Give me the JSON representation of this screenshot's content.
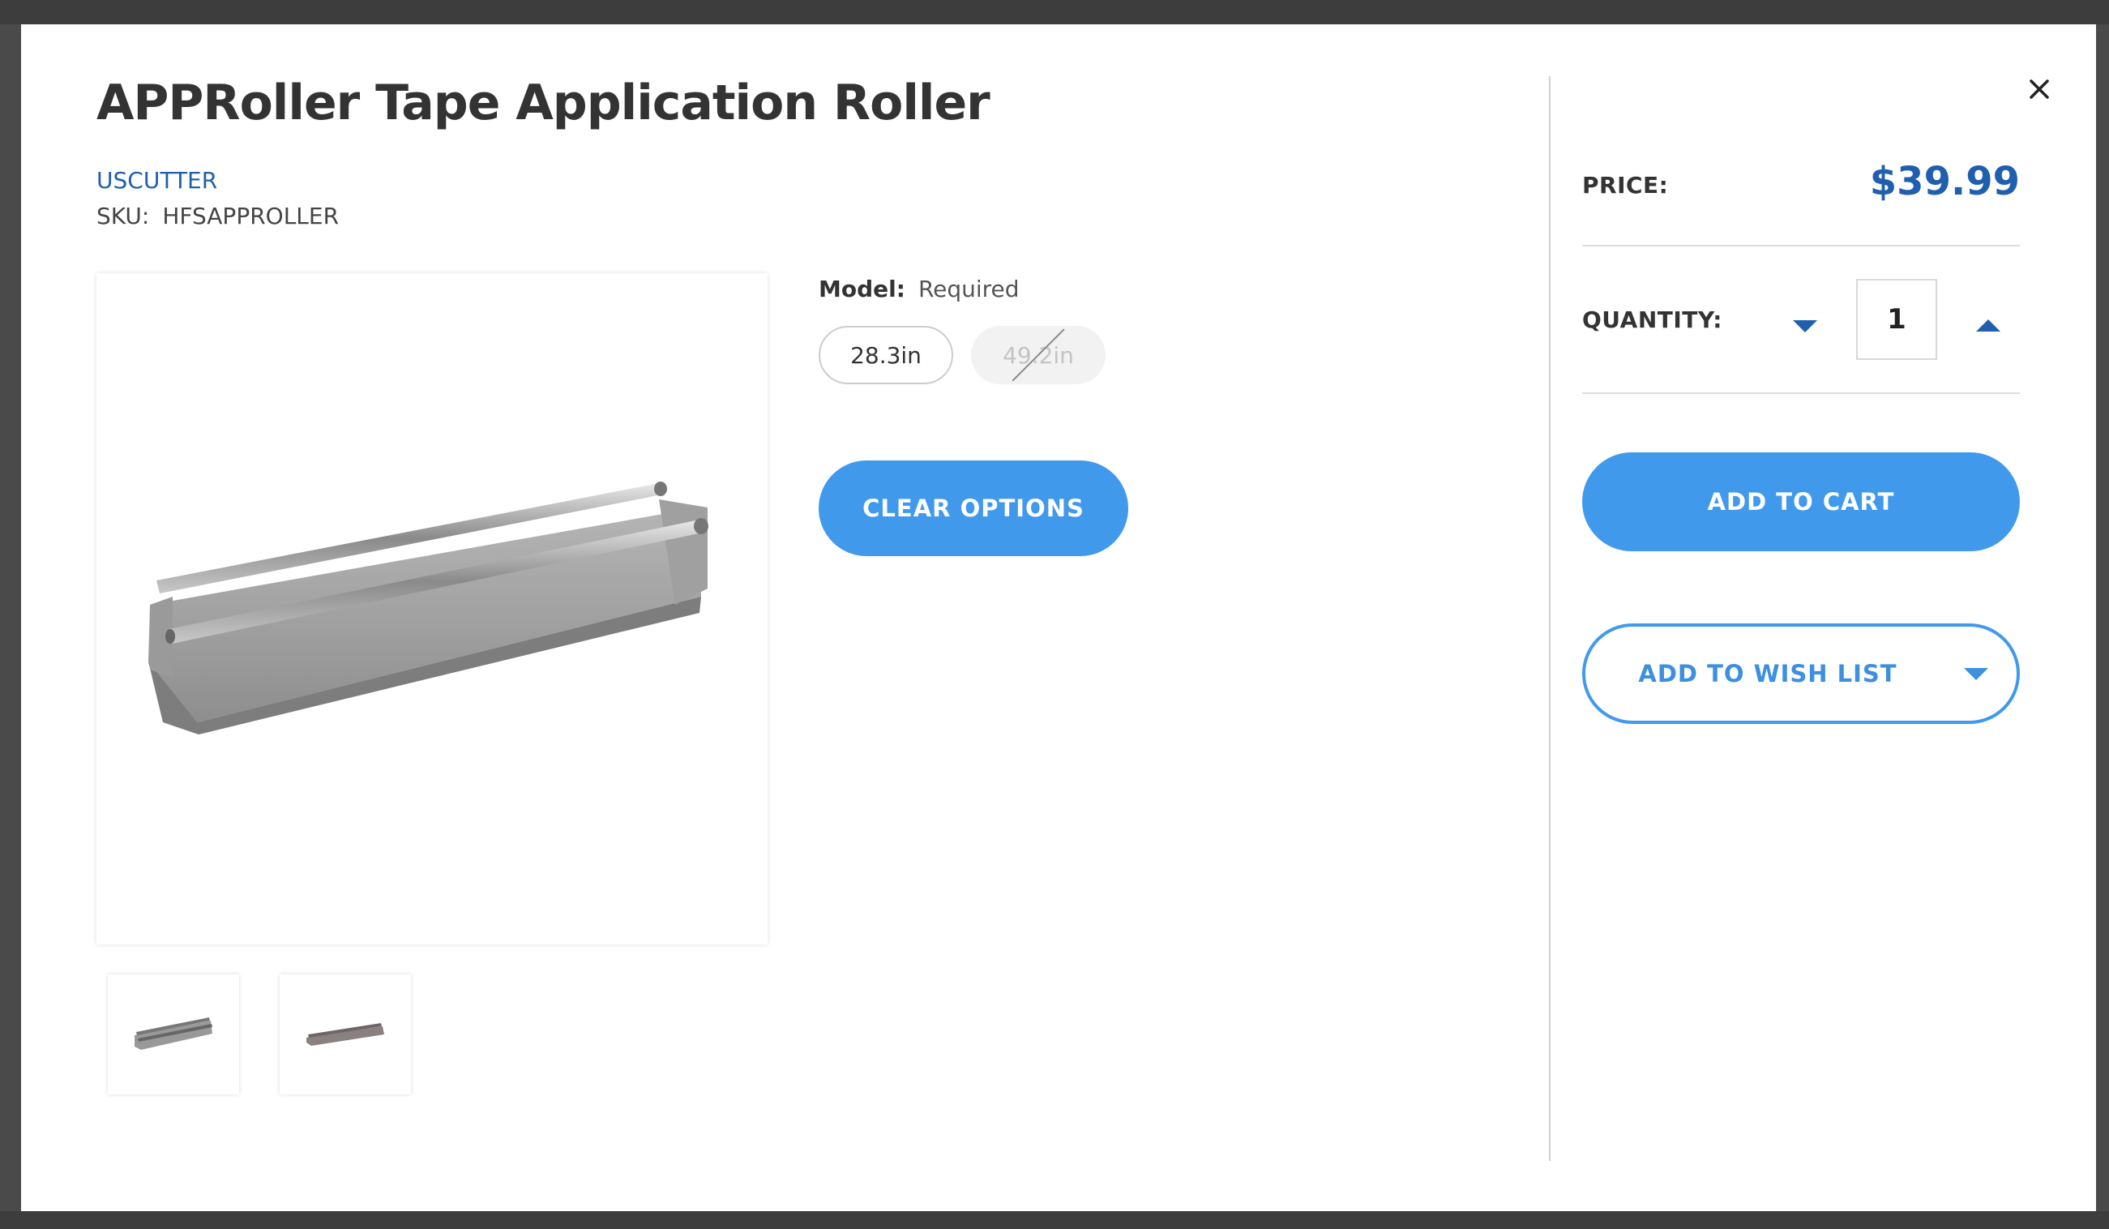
{
  "product": {
    "title": "APPRoller Tape Application Roller",
    "brand": "USCUTTER",
    "sku_label": "SKU:",
    "sku_value": "HFSAPPROLLER"
  },
  "gallery": {
    "main_image": "product-photo-tape-application-roller",
    "thumbnails": [
      "thumbnail-1",
      "thumbnail-2"
    ]
  },
  "options": {
    "model_label": "Model:",
    "model_required": "Required",
    "values": [
      {
        "label": "28.3in",
        "available": true
      },
      {
        "label": "49.2in",
        "available": false
      }
    ],
    "clear_label": "CLEAR OPTIONS"
  },
  "purchase": {
    "price_label": "PRICE:",
    "price_value": "$39.99",
    "quantity_label": "QUANTITY:",
    "quantity_value": "1",
    "add_to_cart_label": "ADD TO CART",
    "add_to_wishlist_label": "ADD TO WISH LIST"
  },
  "icons": {
    "close": "close-icon",
    "quantity_decrease": "caret-down-icon",
    "quantity_increase": "caret-up-icon",
    "wishlist_dropdown": "caret-down-icon"
  },
  "colors": {
    "accent": "#4199ec",
    "brand_link": "#1f5fad",
    "price": "#1f5fad",
    "overlay": "#4a4a4a"
  }
}
